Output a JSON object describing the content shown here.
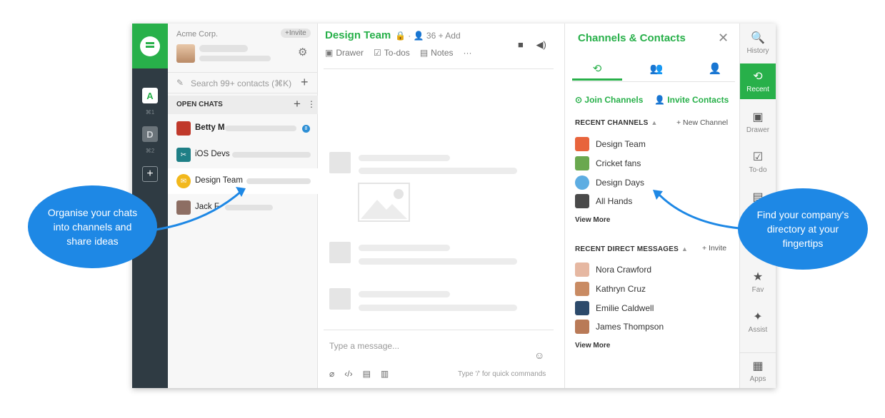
{
  "sidebar": {
    "org_name": "Acme Corp.",
    "invite_label": "+Invite",
    "search_placeholder": "Search 99+ contacts (⌘K)",
    "open_chats_label": "OPEN CHATS",
    "chats": [
      {
        "name": "Betty M",
        "unread": "8"
      },
      {
        "name": "iOS Devs"
      },
      {
        "name": "Design Team"
      },
      {
        "name": "Jack F"
      }
    ]
  },
  "rail": {
    "teams": [
      {
        "letter": "A",
        "shortcut": "⌘1"
      },
      {
        "letter": "D",
        "shortcut": "⌘2"
      }
    ],
    "add_label": "+"
  },
  "main": {
    "channel_title": "Design Team",
    "member_count": "36",
    "add_label": "+ Add",
    "tabs": [
      "Drawer",
      "To-dos",
      "Notes"
    ],
    "more_label": "···",
    "composer_placeholder": "Type a message...",
    "composer_hint": "Type '/' for quick commands"
  },
  "panel": {
    "title": "Channels & Contacts",
    "join_channels": "Join Channels",
    "invite_contacts": "Invite Contacts",
    "recent_channels_label": "RECENT CHANNELS",
    "new_channel_label": "+ New Channel",
    "channels": [
      "Design Team",
      "Cricket fans",
      "Design Days",
      "All Hands"
    ],
    "view_more_1": "View More",
    "recent_dm_label": "RECENT DIRECT MESSAGES",
    "invite_label": "+ Invite",
    "contacts": [
      "Nora Crawford",
      "Kathryn Cruz",
      "Emilie Caldwell",
      "James Thompson"
    ],
    "view_more_2": "View More"
  },
  "right_rail": {
    "items": [
      "History",
      "Recent",
      "Drawer",
      "To-do",
      "Fav",
      "Assist",
      "Apps"
    ],
    "active": "Recent"
  },
  "callouts": {
    "left": "Organise your chats into channels and share ideas",
    "right": "Find your company's directory at your fingertips"
  },
  "colors": {
    "brand_green": "#28b04a",
    "callout_blue": "#1e88e5",
    "rail_dark": "#2f3b43"
  }
}
